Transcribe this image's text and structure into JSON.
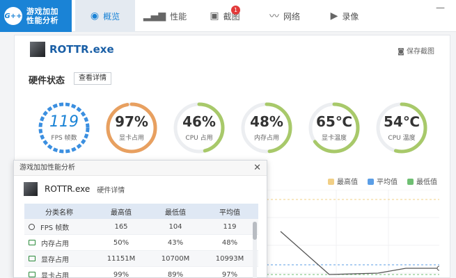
{
  "app": {
    "logo_badge": "G++",
    "logo_line1": "游戏加加",
    "logo_line2": "性能分析"
  },
  "nav": [
    {
      "label": "概览",
      "icon": "eye-icon"
    },
    {
      "label": "性能",
      "icon": "bar-chart-icon"
    },
    {
      "label": "截图",
      "icon": "image-icon",
      "badge": "1"
    },
    {
      "label": "网络",
      "icon": "pulse-icon"
    },
    {
      "label": "录像",
      "icon": "video-icon"
    }
  ],
  "window": {
    "minimize": "—"
  },
  "main": {
    "app_name": "ROTTR.exe",
    "save_screenshot": "保存截图",
    "hw_title": "硬件状态",
    "detail_button": "查看详情"
  },
  "gauges": [
    {
      "value": "119",
      "label": "FPS 帧数",
      "fraction": 0.75,
      "color": "#3b8fe0"
    },
    {
      "value": "97%",
      "label": "显卡占用",
      "fraction": 0.97,
      "color": "#e8a060"
    },
    {
      "value": "46%",
      "label": "CPU 占用",
      "fraction": 0.46,
      "color": "#a8c96a"
    },
    {
      "value": "48%",
      "label": "内存占用",
      "fraction": 0.48,
      "color": "#a8c96a"
    },
    {
      "value": "65℃",
      "label": "显卡温度",
      "fraction": 0.65,
      "color": "#a8c96a"
    },
    {
      "value": "54℃",
      "label": "CPU 温度",
      "fraction": 0.54,
      "color": "#a8c96a"
    }
  ],
  "legend": [
    {
      "label": "最高值",
      "color": "#f1cf86"
    },
    {
      "label": "平均值",
      "color": "#5b9ee6"
    },
    {
      "label": "最低值",
      "color": "#6fbf73"
    }
  ],
  "popup": {
    "title": "游戏加加性能分析",
    "close": "✕",
    "app_name": "ROTTR.exe",
    "app_sub": "硬件详情",
    "columns": [
      "分类名称",
      "最高值",
      "最低值",
      "平均值"
    ],
    "rows": [
      {
        "name": "FPS 帧数",
        "max": "165",
        "min": "104",
        "avg": "119",
        "icon": "dial-icon"
      },
      {
        "name": "内存占用",
        "max": "50%",
        "min": "43%",
        "avg": "48%",
        "icon": "memory-icon"
      },
      {
        "name": "显存占用",
        "max": "11151M",
        "min": "10700M",
        "avg": "10993M",
        "icon": "vram-icon"
      },
      {
        "name": "显卡占用",
        "max": "99%",
        "min": "89%",
        "avg": "97%",
        "icon": "gpu-icon"
      }
    ]
  },
  "chart_data": {
    "type": "line",
    "series": [
      {
        "name": "最高值",
        "values": []
      },
      {
        "name": "平均值",
        "values": []
      },
      {
        "name": "最低值",
        "values": []
      }
    ]
  }
}
